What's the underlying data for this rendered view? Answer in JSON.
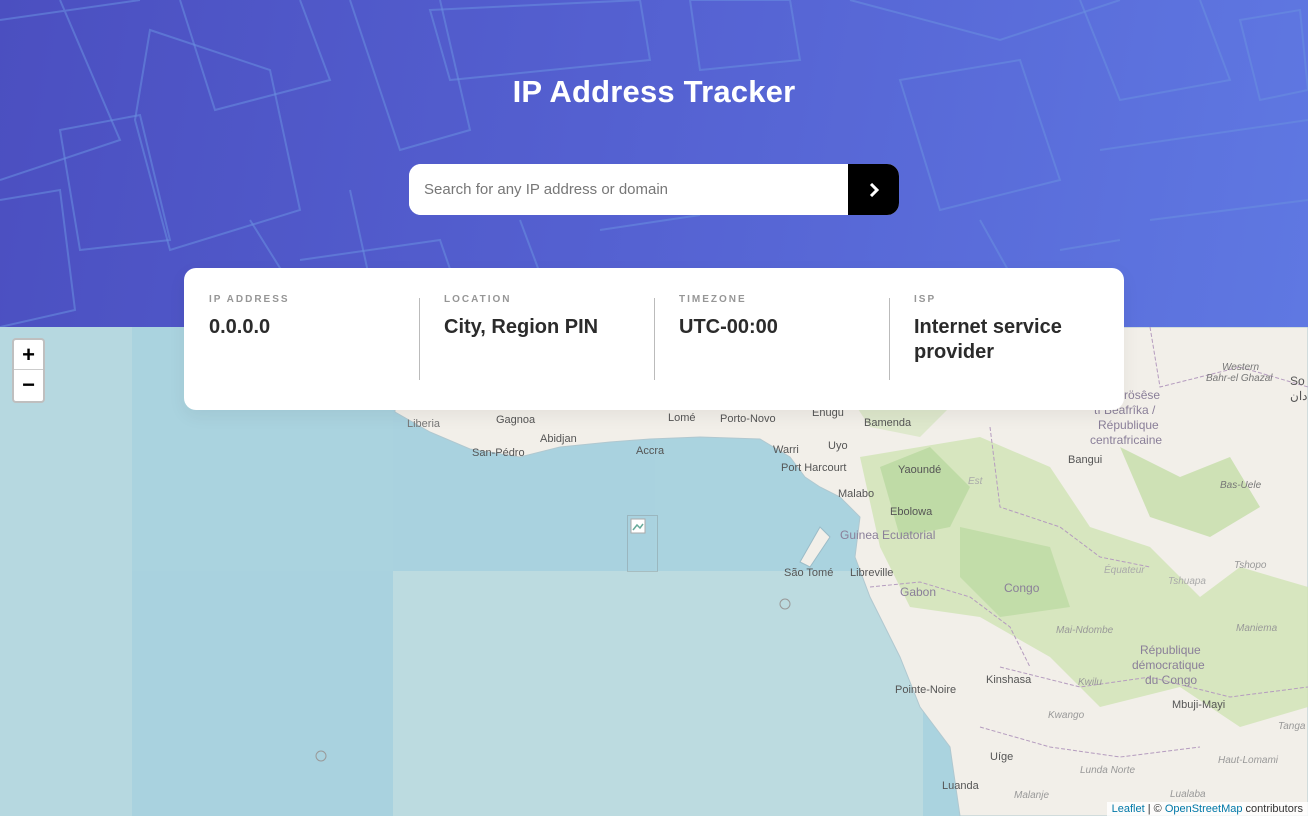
{
  "header": {
    "title": "IP Address Tracker"
  },
  "search": {
    "placeholder": "Search for any IP address or domain",
    "value": "",
    "submit_icon": "chevron-right-icon"
  },
  "info": [
    {
      "label": "IP ADDRESS",
      "value": "0.0.0.0"
    },
    {
      "label": "LOCATION",
      "value": "City, Region PIN"
    },
    {
      "label": "TIMEZONE",
      "value": "UTC-00:00"
    },
    {
      "label": "ISP",
      "value": "Internet service provider"
    }
  ],
  "map": {
    "zoom_in": "+",
    "zoom_out": "−",
    "attribution": {
      "leaflet": "Leaflet",
      "sep": " | © ",
      "osm": "OpenStreetMap",
      "suffix": " contributors"
    },
    "labels": {
      "liberia": "Liberia",
      "gagnoa": "Gagnoa",
      "abidjan": "Abidjan",
      "san_pedro": "San-Pédro",
      "accra": "Accra",
      "lome": "Lomé",
      "porto_novo": "Porto-Novo",
      "enugu": "Enugu",
      "warri": "Warri",
      "uyo": "Uyo",
      "port_harcourt": "Port Harcourt",
      "bamenda": "Bamenda",
      "yaounde": "Yaoundé",
      "malabo": "Malabo",
      "ebolowa": "Ebolowa",
      "guinea": "Guinea Ecuatorial",
      "sao_tome": "São Tomé",
      "libreville": "Libreville",
      "gabon": "Gabon",
      "congo": "Congo",
      "pointe_noire": "Pointe-Noire",
      "kinshasa": "Kinshasa",
      "rdc1": "République",
      "rdc2": "démocratique",
      "rdc3": "du Congo",
      "mbuji": "Mbuji-Mayi",
      "uige": "Uíge",
      "luanda": "Luanda",
      "bangui": "Bangui",
      "rca1": "Ködörösêse",
      "rca2": "tî Bêafrîka /",
      "rca3": "République",
      "rca4": "centrafricaine",
      "bas_uele": "Bas-Uele",
      "western": "Western",
      "bahr": "Bahr-el Ghazal",
      "kwilu": "Kwilu",
      "kwango": "Kwango",
      "lunda": "Lunda Norte",
      "malanje": "Malanje",
      "mai_ndombe": "Mai-Ndombe",
      "maniema": "Maniema",
      "tshopo": "Tshopo",
      "equateur": "Équateur",
      "tshuapa": "Tshuapa",
      "haut_lomami": "Haut-Lomami",
      "tang": "Tanga",
      "lualaba": "Lualaba",
      "est": "Est",
      "so": "So",
      "dan": "دان"
    }
  },
  "colors": {
    "hero_start": "#4b4fc0",
    "hero_end": "#5f78e2",
    "text_dark": "#2b2b2b",
    "label_gray": "#969696",
    "ocean": "#aad3df",
    "land": "#f2efe9",
    "forest": "#c8dfae"
  }
}
